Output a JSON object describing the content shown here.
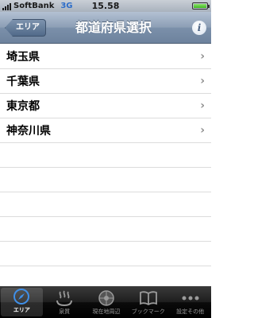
{
  "status_bar": {
    "carrier": "SoftBank",
    "network": "3G",
    "time": "15.58"
  },
  "nav": {
    "back_label": "エリア",
    "title": "都道府県選択",
    "info_icon": "info-icon"
  },
  "list": {
    "items": [
      {
        "label": "埼玉県",
        "chevron": "›"
      },
      {
        "label": "千葉県",
        "chevron": "›"
      },
      {
        "label": "東京都",
        "chevron": "›"
      },
      {
        "label": "神奈川県",
        "chevron": "›"
      }
    ]
  },
  "tabs": [
    {
      "label": "エリア",
      "icon": "compass-icon",
      "selected": true
    },
    {
      "label": "泉質",
      "icon": "hot-spring-icon",
      "selected": false
    },
    {
      "label": "現在地周辺",
      "icon": "location-icon",
      "selected": false
    },
    {
      "label": "ブックマーク",
      "icon": "bookmark-icon",
      "selected": false
    },
    {
      "label": "設定その他",
      "icon": "more-icon",
      "selected": false
    }
  ],
  "colors": {
    "nav_bar": "#8c9eb5",
    "selected_tab_icon": "#3f8fe8"
  }
}
